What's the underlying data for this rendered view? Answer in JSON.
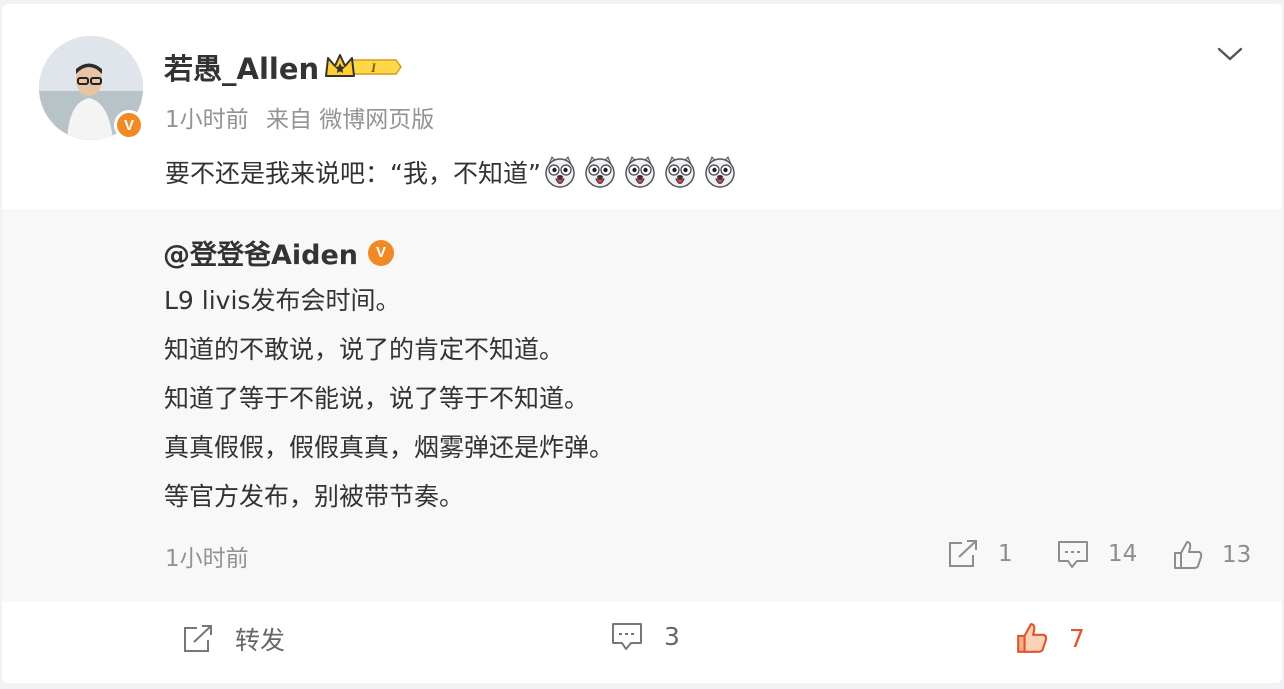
{
  "post": {
    "username": "若愚_Allen",
    "member_badge": "I",
    "time": "1小时前",
    "source": "来自 微博网页版",
    "text": "要不还是我来说吧：“我，不知道”",
    "emoji_count": 5,
    "emoji_name": "doge-tongue-emoji"
  },
  "repost": {
    "username": "@登登爸Aiden",
    "lines": [
      "L9 livis发布会时间。",
      "知道的不敢说，说了的肯定不知道。",
      "知道了等于不能说，说了等于不知道。",
      "真真假假，假假真真，烟雾弹还是炸弹。",
      "等官方发布，别被带节奏。"
    ],
    "time": "1小时前",
    "share_count": "1",
    "comment_count": "14",
    "like_count": "13"
  },
  "actions": {
    "repost_label": "转发",
    "comment_count": "3",
    "like_count": "7"
  },
  "colors": {
    "verified_orange": "#f08a24",
    "liked_accent": "#e0552c",
    "muted_text": "#939393"
  }
}
